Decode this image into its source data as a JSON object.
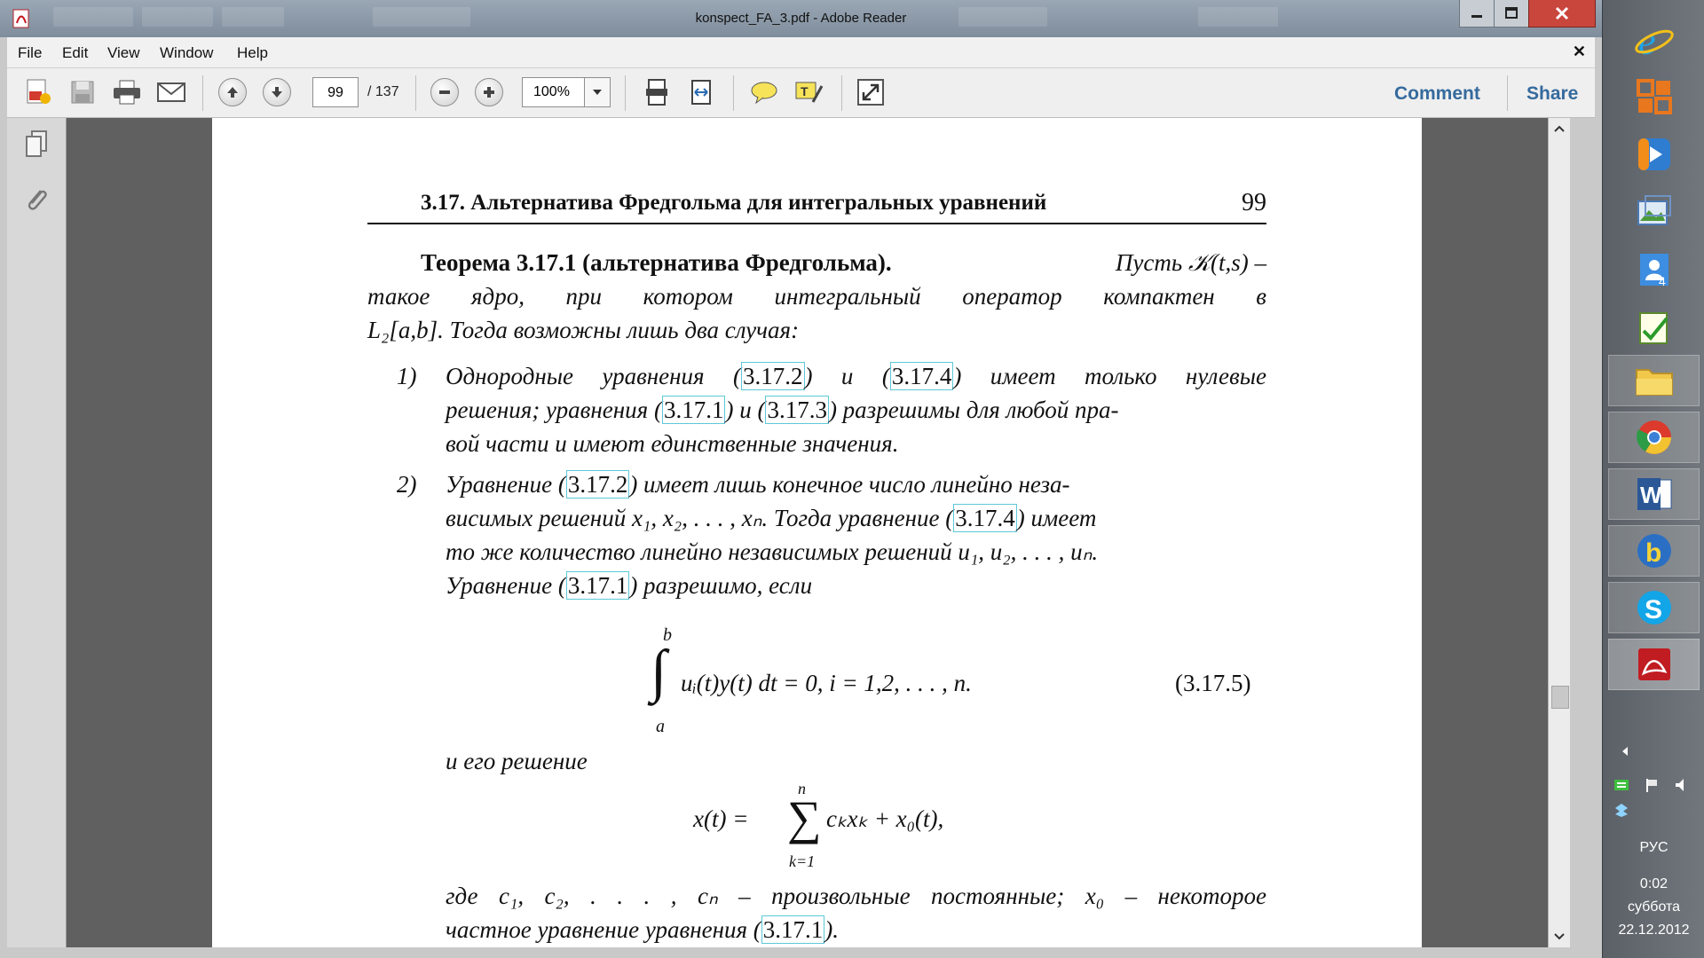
{
  "window": {
    "title": "konspect_FA_3.pdf - Adobe Reader"
  },
  "menu": [
    "File",
    "Edit",
    "View",
    "Window",
    "Help"
  ],
  "toolbar": {
    "current_page": "99",
    "total_pages": "/ 137",
    "zoom": "100%",
    "comment": "Comment",
    "share": "Share"
  },
  "document": {
    "running_head": "3.17.  Альтернатива Фредгольма для интегральных уравнений",
    "page_number": "99",
    "theorem_label": "Теорема 3.17.1 (альтернатива Фредгольма).",
    "theorem_l1_rest": "Пусть 𝒦(t,s) –",
    "theorem_l2": "такое ядро, при котором интегральный оператор компактен в",
    "theorem_l3": "L₂[a,b]. Тогда возможны лишь два случая:",
    "case1_num": "1)",
    "case1_l1_a": "Однородные уравнения (",
    "case1_l1_ref1": "3.17.2",
    "case1_l1_b": ") и (",
    "case1_l1_ref2": "3.17.4",
    "case1_l1_c": ") имеет только нулевые",
    "case1_l2_a": "решения; уравнения (",
    "case1_l2_ref1": "3.17.1",
    "case1_l2_b": ") и (",
    "case1_l2_ref2": "3.17.3",
    "case1_l2_c": ") разрешимы для любой пра-",
    "case1_l3": "вой части и имеют единственные значения.",
    "case2_num": "2)",
    "case2_l1_a": "Уравнение (",
    "case2_l1_ref": "3.17.2",
    "case2_l1_b": ") имеет лишь конечное число линейно неза-",
    "case2_l2_a": "висимых решений x₁, x₂, . . . , xₙ. Тогда уравнение (",
    "case2_l2_ref": "3.17.4",
    "case2_l2_b": ") имеет",
    "case2_l3": "то же количество линейно независимых решений u₁, u₂, . . . , uₙ.",
    "case2_l4_a": "Уравнение (",
    "case2_l4_ref": "3.17.1",
    "case2_l4_b": ") разрешимо, если",
    "eq5_upper": "b",
    "eq5_lower": "a",
    "eq5_body": "uᵢ(t)y(t) dt = 0, i = 1,2, . . . , n.",
    "eq5_number": "(3.17.5)",
    "solution_text": "и его решение",
    "sum_upper": "n",
    "sum_lower": "k=1",
    "sum_left": "x(t) =",
    "sum_right": "cₖxₖ + x₀(t),",
    "where_line": "где c₁, c₂, . . . , cₙ – произвольные постоянные; x₀ – некоторое",
    "last_line_a": "частное уравнение уравнения (",
    "last_line_ref": "3.17.1",
    "last_line_b": ")."
  },
  "taskbar": {
    "language": "РУС",
    "time": "0:02",
    "day": "суббота",
    "date": "22.12.2012"
  },
  "icons": [
    "pdf-app-icon",
    "create-pdf-icon",
    "save-icon",
    "print-icon",
    "email-icon",
    "prev-page-icon",
    "next-page-icon",
    "zoom-out-icon",
    "zoom-in-icon",
    "fit-page-icon",
    "fit-width-icon",
    "sticky-note-icon",
    "highlight-icon",
    "fullscreen-icon",
    "pages-panel-icon",
    "attachments-icon",
    "ie-icon",
    "office-icon",
    "media-player-icon",
    "photo-icon",
    "contacts-icon",
    "notepad-icon",
    "folder-icon",
    "chrome-icon",
    "word-icon",
    "bing-icon",
    "skype-icon",
    "acrobat-icon"
  ]
}
